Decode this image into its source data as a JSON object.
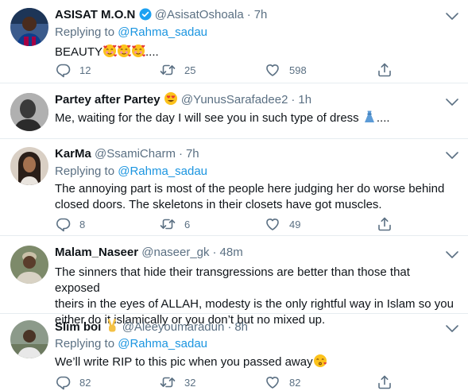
{
  "tweets": [
    {
      "name": "ASISAT M.O.N",
      "handle": "@AsisatOshoala",
      "time": "7h",
      "verified": true,
      "reply_label": "Replying to",
      "reply_to": "@Rahma_sadau",
      "text_before": "BEAUTY",
      "text_after": "....",
      "emoji": "smiling-face-with-hearts x3",
      "replies": "12",
      "retweets": "25",
      "likes": "598"
    },
    {
      "name": "Partey after Partey",
      "handle": "@YunusSarafadee2",
      "time": "1h",
      "name_emoji": "heart-eyes",
      "text_before": "Me, waiting for the day I will see you in such type of dress",
      "text_after": "....",
      "emoji": "dress"
    },
    {
      "name": "KarMa",
      "handle": "@SsamiCharm",
      "time": "7h",
      "reply_label": "Replying to",
      "reply_to": "@Rahma_sadau",
      "text_line1": "The annoying part is most of the people here judging her do worse behind",
      "text_line2": "closed doors. The skeletons in their closets have got muscles.",
      "replies": "8",
      "retweets": "6",
      "likes": "49"
    },
    {
      "name": "Malam_Naseer",
      "handle": "@naseer_gk",
      "time": "48m",
      "text_line1": "The sinners that hide their transgressions are better than those that exposed",
      "text_line2": "theirs in the eyes of ALLAH, modesty is the only rightful way in Islam so you",
      "text_line3": "either do it islamically or you don’t but no mixed up."
    },
    {
      "name": "Slim boi",
      "handle": "@Aleeyoumaradun",
      "time": "8h",
      "name_emoji": "victory-hand",
      "reply_label": "Replying to",
      "reply_to": "@Rahma_sadau",
      "text_before": "We’ll write RIP to this pic when you passed away",
      "emoji": "kissing-face-smiling-eyes",
      "replies": "82",
      "retweets": "32",
      "likes": "82"
    }
  ],
  "dot": "·",
  "icons": [
    "reply-icon",
    "retweet-icon",
    "like-icon",
    "share-icon",
    "more-icon",
    "verified-badge-icon"
  ],
  "colors": {
    "link": "#1b95e0",
    "secondary": "#5b7083",
    "text": "#0f1419",
    "divider": "#e6ecf0",
    "verified": "#1da1f2"
  }
}
